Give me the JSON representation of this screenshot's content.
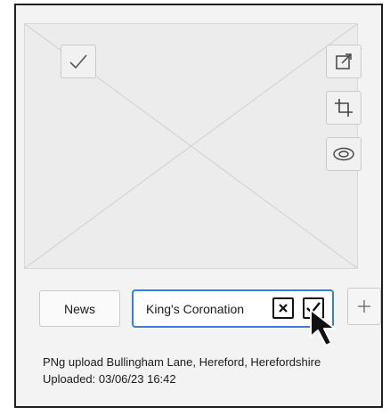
{
  "image_card": {
    "toolbar": {
      "select_icon": "checkmark-icon",
      "open_icon": "open-external-icon",
      "crop_icon": "crop-icon",
      "preview_icon": "eye-icon"
    }
  },
  "tags": {
    "existing": [
      "News"
    ],
    "editing_value": "King's Coronation",
    "cancel_icon": "close-icon",
    "confirm_icon": "check-icon",
    "add_icon": "plus-icon"
  },
  "details": {
    "upload_description": "PNg upload Bullingham Lane, Hereford, Herefordshire",
    "uploaded_label": "Uploaded: 03/06/23  16:42"
  },
  "colors": {
    "input_focus": "#3b7fd4",
    "frame": "#1f1f1f"
  }
}
